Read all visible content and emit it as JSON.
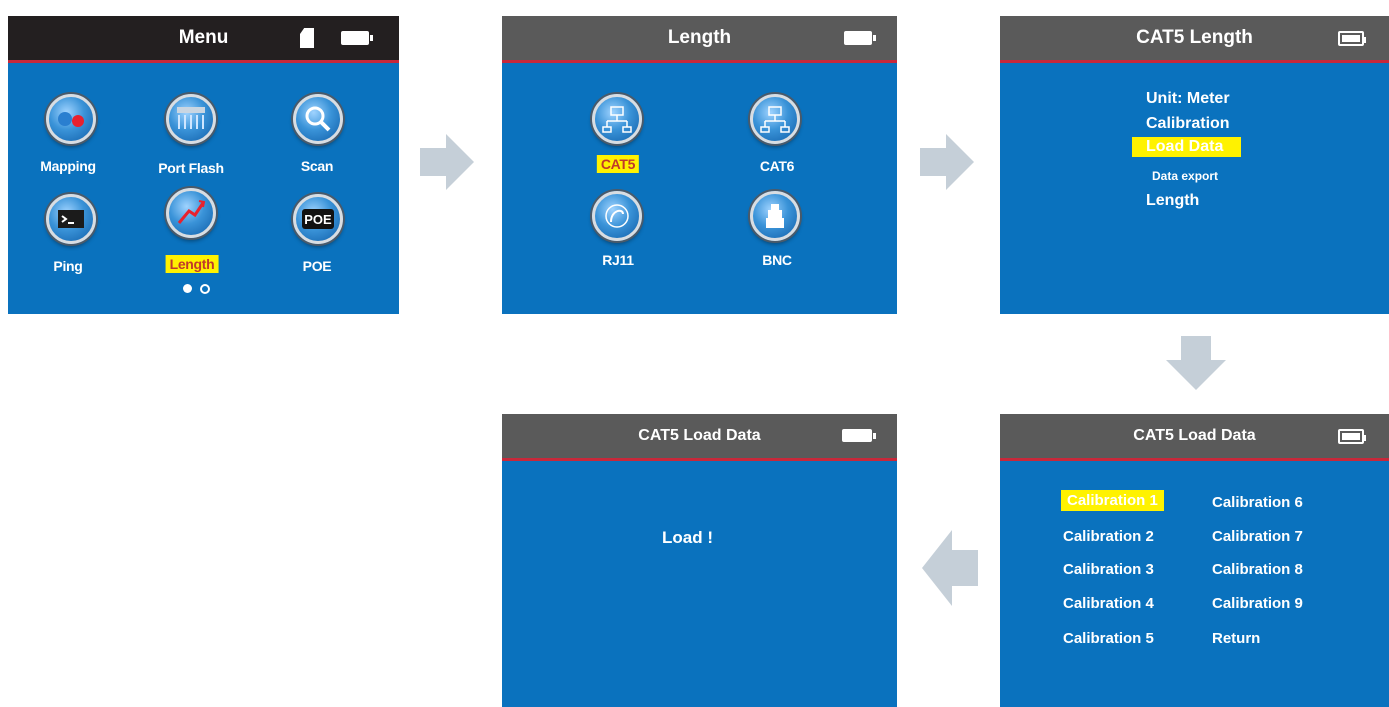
{
  "screen1": {
    "title": "Menu",
    "items": [
      {
        "label": "Mapping",
        "icon": "mapping-icon"
      },
      {
        "label": "Port Flash",
        "icon": "port-flash-icon"
      },
      {
        "label": "Scan",
        "icon": "scan-icon"
      },
      {
        "label": "Ping",
        "icon": "ping-icon"
      },
      {
        "label": "Length",
        "icon": "length-icon"
      },
      {
        "label": "POE",
        "icon": "poe-icon"
      }
    ],
    "selected": "Length",
    "poe_icon_text": "POE"
  },
  "screen2": {
    "title": "Length",
    "items": [
      {
        "label": "CAT5",
        "icon": "cat5-icon"
      },
      {
        "label": "CAT6",
        "icon": "cat6-icon"
      },
      {
        "label": "RJ11",
        "icon": "rj11-icon"
      },
      {
        "label": "BNC",
        "icon": "bnc-icon"
      }
    ],
    "selected": "CAT5"
  },
  "screen3": {
    "title": "CAT5 Length",
    "items": [
      "Unit: Meter",
      "Calibration",
      "Load Data",
      "Data export",
      "Length"
    ],
    "selected": "Load Data"
  },
  "screen4": {
    "title": "CAT5 Load Data",
    "message": "Load !"
  },
  "screen5": {
    "title": "CAT5 Load Data",
    "left_column": [
      "Calibration 1",
      "Calibration 2",
      "Calibration 3",
      "Calibration 4",
      "Calibration 5"
    ],
    "right_column": [
      "Calibration 6",
      "Calibration 7",
      "Calibration 8",
      "Calibration 9",
      "Return"
    ],
    "selected": "Calibration 1"
  },
  "colors": {
    "screen_bg": "#0a72be",
    "highlight": "#fff200",
    "title_accent": "#c8283a",
    "arrow": "#c5cfd8"
  }
}
